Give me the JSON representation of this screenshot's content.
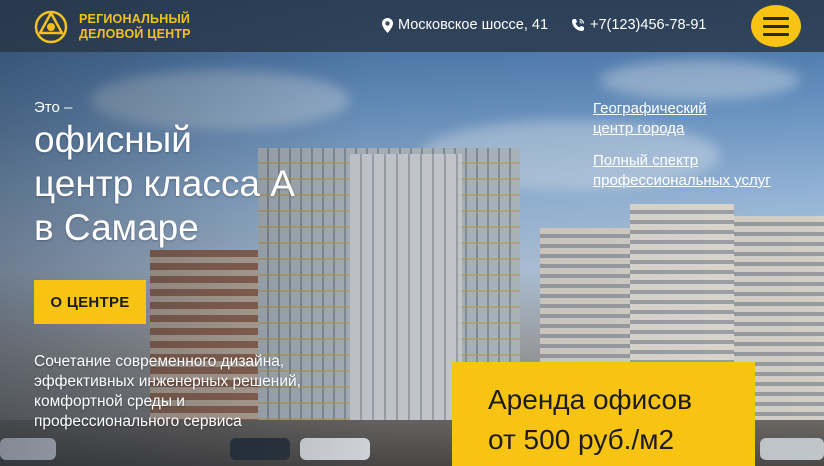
{
  "header": {
    "brand_line1": "РЕГИОНАЛЬНЫЙ",
    "brand_line2": "ДЕЛОВОЙ ЦЕНТР",
    "address": "Московское шоссе, 41",
    "phone": "+7(123)456-78-91",
    "address_icon": "map-pin-icon",
    "phone_icon": "phone-icon",
    "menu_icon": "hamburger-menu-icon"
  },
  "hero": {
    "eyebrow": "Это –",
    "title_line1": "офисный",
    "title_line2": "центр класса А",
    "title_line3": "в Самаре",
    "about_button": "О ЦЕНТРЕ",
    "desc_line1": "Сочетание современного дизайна,",
    "desc_line2": "эффективных инженерных решений,",
    "desc_line3": "комфортной среды и",
    "desc_line4": "профессионального сервиса"
  },
  "links": {
    "link1_line1": "Географический",
    "link1_line2": "центр города",
    "link2_line1": "Полный спектр",
    "link2_line2": "профессиональных услуг"
  },
  "promo": {
    "line1": "Аренда офисов",
    "line2": "от 500 руб./м2"
  },
  "colors": {
    "accent": "#f7c414",
    "header_bg": "#283444",
    "text": "#ffffff"
  }
}
